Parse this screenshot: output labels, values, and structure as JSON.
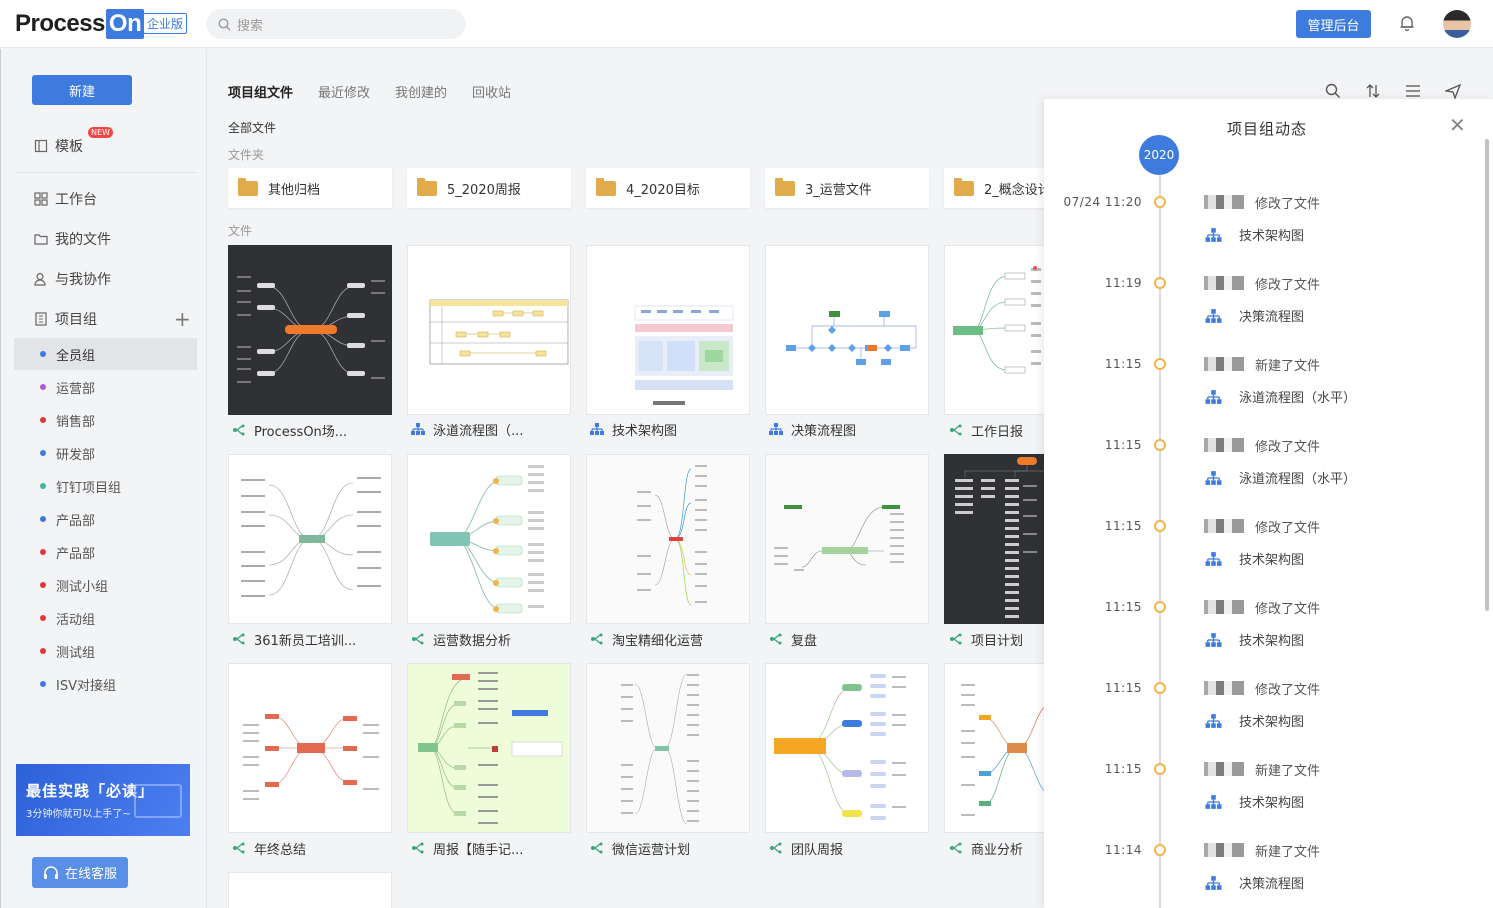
{
  "header": {
    "logo_main": "Process",
    "logo_on": "On",
    "edition": "企业版",
    "search_placeholder": "搜索",
    "admin_button": "管理后台",
    "bell_icon": "bell-icon"
  },
  "sidebar": {
    "new_button": "新建",
    "template": "模板",
    "template_badge": "NEW",
    "workspace": "工作台",
    "my_files": "我的文件",
    "shared_with_me": "与我协作",
    "project_groups": "项目组",
    "groups": [
      {
        "label": "全员组",
        "color": "#3d7bde"
      },
      {
        "label": "运营部",
        "color": "#b05ad8"
      },
      {
        "label": "销售部",
        "color": "#e03a3a"
      },
      {
        "label": "研发部",
        "color": "#3d7bde"
      },
      {
        "label": "钉钉项目组",
        "color": "#3ab8a0"
      },
      {
        "label": "产品部",
        "color": "#3d7bde"
      },
      {
        "label": "产品部",
        "color": "#e03a3a"
      },
      {
        "label": "测试小组",
        "color": "#e03a3a"
      },
      {
        "label": "活动组",
        "color": "#e03a3a"
      },
      {
        "label": "测试组",
        "color": "#e03a3a"
      },
      {
        "label": "ISV对接组",
        "color": "#3d7bde"
      }
    ],
    "promo_title": "最佳实践「必读」",
    "promo_sub": "3分钟你就可以上手了~",
    "service_button": "在线客服"
  },
  "main": {
    "tabs": [
      "项目组文件",
      "最近修改",
      "我创建的",
      "回收站"
    ],
    "all_files": "全部文件",
    "folders_label": "文件夹",
    "files_label": "文件",
    "folders": [
      "其他归档",
      "5_2020周报",
      "4_2020目标",
      "3_运营文件",
      "2_概念设计"
    ],
    "files": [
      {
        "name": "ProcessOn场...",
        "type": "mindmap"
      },
      {
        "name": "泳道流程图（...",
        "type": "flow"
      },
      {
        "name": "技术架构图",
        "type": "flow"
      },
      {
        "name": "决策流程图",
        "type": "flow"
      },
      {
        "name": "工作日报",
        "type": "mindmap"
      },
      {
        "name": "361新员工培训...",
        "type": "mindmap"
      },
      {
        "name": "运营数据分析",
        "type": "mindmap"
      },
      {
        "name": "淘宝精细化运营",
        "type": "mindmap"
      },
      {
        "name": "复盘",
        "type": "mindmap"
      },
      {
        "name": "项目计划",
        "type": "mindmap"
      },
      {
        "name": "年终总结",
        "type": "mindmap"
      },
      {
        "name": "周报【随手记...",
        "type": "mindmap"
      },
      {
        "name": "微信运营计划",
        "type": "mindmap"
      },
      {
        "name": "团队周报",
        "type": "mindmap"
      },
      {
        "name": "商业分析",
        "type": "mindmap"
      }
    ]
  },
  "activity": {
    "title": "项目组动态",
    "year": "2020",
    "events": [
      {
        "time": "07/24 11:20",
        "action": "修改了文件",
        "file": "技术架构图"
      },
      {
        "time": "11:19",
        "action": "修改了文件",
        "file": "决策流程图"
      },
      {
        "time": "11:15",
        "action": "新建了文件",
        "file": "泳道流程图（水平）"
      },
      {
        "time": "11:15",
        "action": "修改了文件",
        "file": "泳道流程图（水平）"
      },
      {
        "time": "11:15",
        "action": "修改了文件",
        "file": "技术架构图"
      },
      {
        "time": "11:15",
        "action": "修改了文件",
        "file": "技术架构图"
      },
      {
        "time": "11:15",
        "action": "修改了文件",
        "file": "技术架构图"
      },
      {
        "time": "11:15",
        "action": "新建了文件",
        "file": "技术架构图"
      },
      {
        "time": "11:14",
        "action": "新建了文件",
        "file": "决策流程图"
      }
    ]
  }
}
